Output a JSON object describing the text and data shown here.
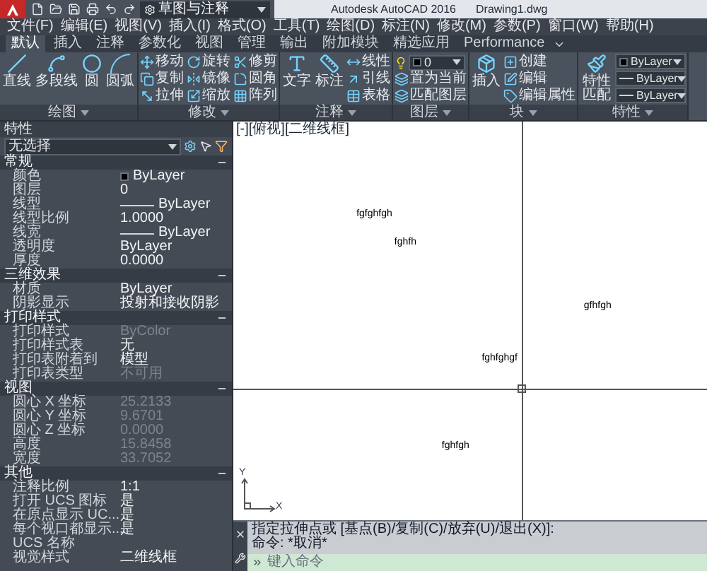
{
  "title_bar": {
    "workspace": "草图与注释",
    "app_title": "Autodesk AutoCAD 2016",
    "document": "Drawing1.dwg"
  },
  "menu_bar": [
    "文件(F)",
    "编辑(E)",
    "视图(V)",
    "插入(I)",
    "格式(O)",
    "工具(T)",
    "绘图(D)",
    "标注(N)",
    "修改(M)",
    "参数(P)",
    "窗口(W)",
    "帮助(H)"
  ],
  "ribbon_tabs": [
    {
      "label": "默认",
      "selected": true
    },
    {
      "label": "插入",
      "selected": false
    },
    {
      "label": "注释",
      "selected": false
    },
    {
      "label": "参数化",
      "selected": false
    },
    {
      "label": "视图",
      "selected": false
    },
    {
      "label": "管理",
      "selected": false
    },
    {
      "label": "输出",
      "selected": false
    },
    {
      "label": "附加模块",
      "selected": false
    },
    {
      "label": "精选应用",
      "selected": false
    },
    {
      "label": "Performance",
      "selected": false
    }
  ],
  "ribbon_panels": [
    {
      "label": "绘图",
      "large": [
        "直线",
        "多段线",
        "圆",
        "圆弧"
      ]
    },
    {
      "label": "修改",
      "small": [
        "移动",
        "旋转",
        "修剪",
        "复制",
        "镜像",
        "圆角",
        "拉伸",
        "缩放",
        "阵列"
      ]
    },
    {
      "label": "注释",
      "large": [
        "文字",
        "标注"
      ],
      "small": [
        "线性",
        "引线",
        "表格"
      ]
    },
    {
      "label": "图层",
      "layer": "0",
      "small": [
        "置为当前",
        "匹配图层"
      ]
    },
    {
      "label": "块",
      "large": [
        "插入"
      ],
      "small": [
        "创建",
        "编辑",
        "编辑属性"
      ]
    },
    {
      "label": "特性",
      "large": [
        "特性匹配"
      ],
      "dropdowns": [
        "ByLayer",
        "ByLayer",
        "ByLayer"
      ]
    }
  ],
  "properties": {
    "title": "特性",
    "selection": "无选择",
    "sections": [
      {
        "title": "常规",
        "expanded": true,
        "rows": [
          {
            "label": "颜色",
            "value": "ByLayer",
            "kind": "color",
            "disabled": false
          },
          {
            "label": "图层",
            "value": "0",
            "kind": "text",
            "disabled": false
          },
          {
            "label": "线型",
            "value": "ByLayer",
            "kind": "line",
            "disabled": false
          },
          {
            "label": "线型比例",
            "value": "1.0000",
            "kind": "text",
            "disabled": false
          },
          {
            "label": "线宽",
            "value": "ByLayer",
            "kind": "line",
            "disabled": false
          },
          {
            "label": "透明度",
            "value": "ByLayer",
            "kind": "text",
            "disabled": false
          },
          {
            "label": "厚度",
            "value": "0.0000",
            "kind": "text",
            "disabled": false
          }
        ]
      },
      {
        "title": "三维效果",
        "expanded": true,
        "rows": [
          {
            "label": "材质",
            "value": "ByLayer",
            "kind": "text",
            "disabled": false
          },
          {
            "label": "阴影显示",
            "value": "投射和接收阴影",
            "kind": "text",
            "disabled": false
          }
        ]
      },
      {
        "title": "打印样式",
        "expanded": true,
        "rows": [
          {
            "label": "打印样式",
            "value": "ByColor",
            "kind": "text",
            "disabled": true
          },
          {
            "label": "打印样式表",
            "value": "无",
            "kind": "text",
            "disabled": false
          },
          {
            "label": "打印表附着到",
            "value": "模型",
            "kind": "text",
            "disabled": false
          },
          {
            "label": "打印表类型",
            "value": "不可用",
            "kind": "text",
            "disabled": true
          }
        ]
      },
      {
        "title": "视图",
        "expanded": true,
        "rows": [
          {
            "label": "圆心 X 坐标",
            "value": "25.2133",
            "kind": "text",
            "disabled": true
          },
          {
            "label": "圆心 Y 坐标",
            "value": "9.6701",
            "kind": "text",
            "disabled": true
          },
          {
            "label": "圆心 Z 坐标",
            "value": "0.0000",
            "kind": "text",
            "disabled": true
          },
          {
            "label": "高度",
            "value": "15.8458",
            "kind": "text",
            "disabled": true
          },
          {
            "label": "宽度",
            "value": "33.7052",
            "kind": "text",
            "disabled": true
          }
        ]
      },
      {
        "title": "其他",
        "expanded": true,
        "rows": [
          {
            "label": "注释比例",
            "value": "1:1",
            "kind": "text",
            "disabled": false
          },
          {
            "label": "打开 UCS 图标",
            "value": "是",
            "kind": "text",
            "disabled": false
          },
          {
            "label": "在原点显示 UC...",
            "value": "是",
            "kind": "text",
            "disabled": false
          },
          {
            "label": "每个视口都显示...",
            "value": "是",
            "kind": "text",
            "disabled": false
          },
          {
            "label": "UCS 名称",
            "disabled": false
          },
          {
            "label": "视觉样式",
            "value": "二维线框",
            "kind": "text",
            "disabled": false
          }
        ]
      }
    ]
  },
  "canvas": {
    "viewport_label": "[-][俯视][二维线框]",
    "texts": [
      "fgfghfgh",
      "fghfh",
      "gfhfgh",
      "fghfghgf",
      "fghfgh"
    ],
    "ucs": {
      "x": "X",
      "y": "Y"
    }
  },
  "command_line": {
    "history": [
      "指定拉伸点或 [基点(B)/复制(C)/放弃(U)/退出(X)]:",
      "命令: *取消*"
    ],
    "placeholder": "键入命令"
  }
}
